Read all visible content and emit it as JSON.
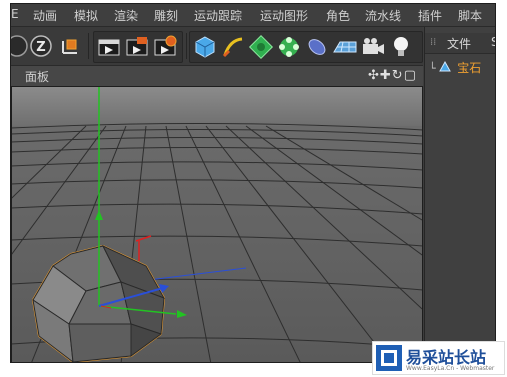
{
  "menubar": {
    "items": [
      "E",
      "动画",
      "模拟",
      "渲染",
      "雕刻",
      "运动跟踪",
      "运动图形",
      "角色",
      "流水线",
      "插件",
      "脚本"
    ]
  },
  "viewport": {
    "title": "面板"
  },
  "objects_panel": {
    "tabs": [
      "文件",
      "S"
    ],
    "items": [
      {
        "name": "宝石",
        "icon": "gem-object-icon"
      }
    ]
  },
  "watermark": {
    "title": "易采站长站",
    "subtitle": "Www.EasyLa.Cn - Webmaster"
  },
  "colors": {
    "accent": "#f0a030",
    "axis_y": "#22c322",
    "axis_x": "#e02020",
    "axis_z": "#2a4fd8"
  }
}
